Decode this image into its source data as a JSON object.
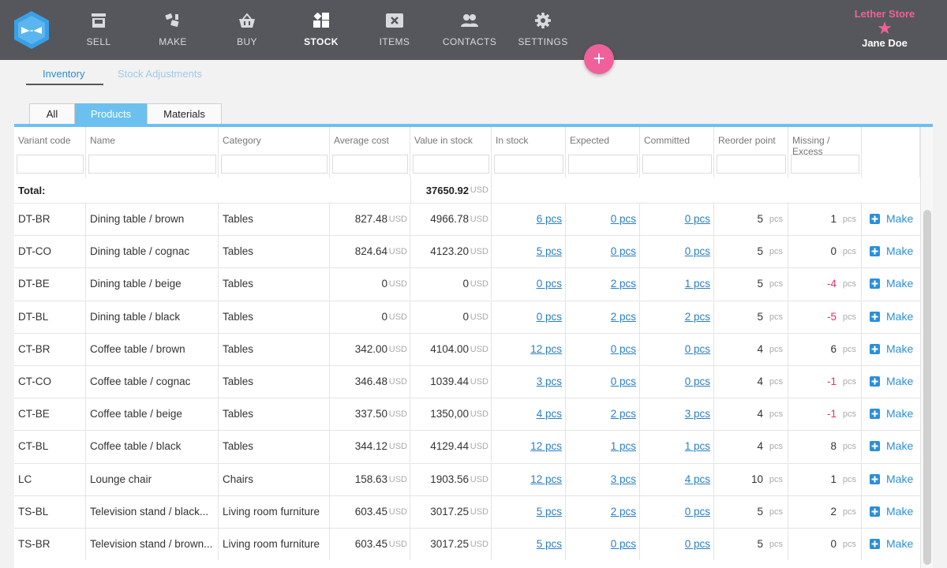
{
  "nav": {
    "items": [
      {
        "label": "SELL",
        "icon": "store-icon"
      },
      {
        "label": "MAKE",
        "icon": "make-icon"
      },
      {
        "label": "BUY",
        "icon": "basket-icon"
      },
      {
        "label": "STOCK",
        "icon": "stock-icon"
      },
      {
        "label": "ITEMS",
        "icon": "items-icon"
      },
      {
        "label": "CONTACTS",
        "icon": "contacts-icon"
      },
      {
        "label": "SETTINGS",
        "icon": "gear-icon"
      }
    ],
    "active": "STOCK"
  },
  "account": {
    "store_name": "Lether Store",
    "star": "★",
    "user_name": "Jane Doe"
  },
  "fab": {
    "label": "+"
  },
  "subtabs": {
    "inventory": "Inventory",
    "adjustments": "Stock Adjustments"
  },
  "filter_tabs": {
    "all": "All",
    "products": "Products",
    "materials": "Materials",
    "active": "Products"
  },
  "columns": {
    "variant_code": "Variant code",
    "name": "Name",
    "category": "Category",
    "average_cost": "Average cost",
    "value_in_stock": "Value in stock",
    "in_stock": "In stock",
    "expected": "Expected",
    "committed": "Committed",
    "reorder_point": "Reorder point",
    "missing_excess": "Missing / Excess"
  },
  "total": {
    "label": "Total:",
    "value": "37650.92",
    "unit": "USD"
  },
  "units": {
    "currency": "USD",
    "qty": "pcs"
  },
  "make_label": "Make",
  "rows": [
    {
      "code": "DT-BR",
      "name": "Dining table / brown",
      "category": "Tables",
      "avg_cost": "827.48",
      "value": "4966.78",
      "in_stock": "6 pcs",
      "expected": "0 pcs",
      "committed": "0 pcs",
      "reorder": "5",
      "missing": "1"
    },
    {
      "code": "DT-CO",
      "name": "Dining table / cognac",
      "category": "Tables",
      "avg_cost": "824.64",
      "value": "4123.20",
      "in_stock": "5 pcs",
      "expected": "0 pcs",
      "committed": "0 pcs",
      "reorder": "5",
      "missing": "0"
    },
    {
      "code": "DT-BE",
      "name": "Dining table / beige",
      "category": "Tables",
      "avg_cost": "0",
      "value": "0",
      "in_stock": "0 pcs",
      "expected": "2 pcs",
      "committed": "1 pcs",
      "reorder": "5",
      "missing": "-4"
    },
    {
      "code": "DT-BL",
      "name": "Dining table / black",
      "category": "Tables",
      "avg_cost": "0",
      "value": "0",
      "in_stock": "0 pcs",
      "expected": "2 pcs",
      "committed": "2 pcs",
      "reorder": "5",
      "missing": "-5"
    },
    {
      "code": "CT-BR",
      "name": "Coffee table / brown",
      "category": "Tables",
      "avg_cost": "342.00",
      "value": "4104.00",
      "in_stock": "12 pcs",
      "expected": "0 pcs",
      "committed": "0 pcs",
      "reorder": "4",
      "missing": "6"
    },
    {
      "code": "CT-CO",
      "name": "Coffee table / cognac",
      "category": "Tables",
      "avg_cost": "346.48",
      "value": "1039.44",
      "in_stock": "3 pcs",
      "expected": "0 pcs",
      "committed": "0 pcs",
      "reorder": "4",
      "missing": "-1"
    },
    {
      "code": "CT-BE",
      "name": "Coffee table / beige",
      "category": "Tables",
      "avg_cost": "337.50",
      "value": "1350,00",
      "in_stock": "4 pcs",
      "expected": "2 pcs",
      "committed": "3 pcs",
      "reorder": "4",
      "missing": "-1"
    },
    {
      "code": "CT-BL",
      "name": "Coffee table / black",
      "category": "Tables",
      "avg_cost": "344.12",
      "value": "4129.44",
      "in_stock": "12 pcs",
      "expected": "1 pcs",
      "committed": "1 pcs",
      "reorder": "4",
      "missing": "8"
    },
    {
      "code": "LC",
      "name": "Lounge chair",
      "category": "Chairs",
      "avg_cost": "158.63",
      "value": "1903.56",
      "in_stock": "12 pcs",
      "expected": "3 pcs",
      "committed": "4 pcs",
      "reorder": "10",
      "missing": "1"
    },
    {
      "code": "TS-BL",
      "name": "Television stand / black...",
      "category": "Living room furniture",
      "avg_cost": "603.45",
      "value": "3017.25",
      "in_stock": "5 pcs",
      "expected": "2 pcs",
      "committed": "0 pcs",
      "reorder": "5",
      "missing": "2"
    },
    {
      "code": "TS-BR",
      "name": "Television stand / brown...",
      "category": "Living room furniture",
      "avg_cost": "603.45",
      "value": "3017.25",
      "in_stock": "5 pcs",
      "expected": "0 pcs",
      "committed": "0 pcs",
      "reorder": "5",
      "missing": "0"
    }
  ],
  "colors": {
    "nav_bg": "#55575c",
    "accent_pink": "#f0609a",
    "accent_blue": "#6cc0f0",
    "link": "#2a7fc4",
    "negative": "#e0306a"
  }
}
